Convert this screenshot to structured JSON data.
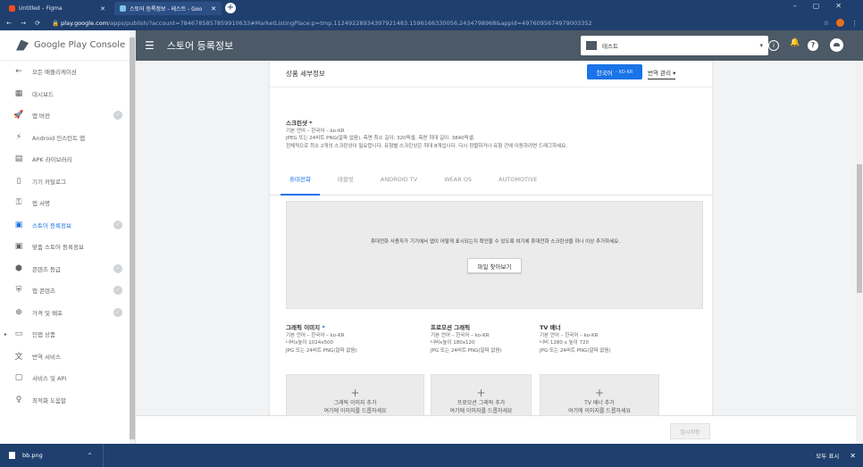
{
  "browser": {
    "tabs": [
      {
        "title": "Untitled – Figma",
        "active": false
      },
      {
        "title": "스토어 등록정보 - 테스트 - Goo",
        "active": true
      }
    ],
    "new_tab": "+",
    "url_domain": "play.google.com",
    "url_rest": "/apps/publish/?account=7846785857859910633#MarketListingPlace:p=tmp.112492289343979214​83.1596166330056.2434798968&appid=4976095674979003352"
  },
  "appbar": {
    "title": "스토어 등록정보",
    "app_selector": "테스트"
  },
  "sidebar": {
    "logo": "Google Play Console",
    "items": [
      {
        "label": "모든 애플리케이션",
        "icon": "←"
      },
      {
        "label": "대시보드",
        "icon": "▦"
      },
      {
        "label": "앱 버전",
        "icon": "🚀",
        "check": "✓"
      },
      {
        "label": "Android 인스턴트 앱",
        "icon": "⚡"
      },
      {
        "label": "APK 라이브러리",
        "icon": "▤"
      },
      {
        "label": "기기 카탈로그",
        "icon": "▯"
      },
      {
        "label": "앱 서명",
        "icon": "⚿"
      },
      {
        "label": "스토어 등록정보",
        "icon": "▣",
        "check": "✓"
      },
      {
        "label": "맞춤 스토어 등록정보",
        "icon": "▣"
      },
      {
        "label": "콘텐츠 등급",
        "icon": "⬢",
        "check": "✓"
      },
      {
        "label": "앱 콘텐츠",
        "icon": "⛨",
        "check": "✓"
      },
      {
        "label": "가격 및 배포",
        "icon": "⊕",
        "check": "✓"
      },
      {
        "label": "인앱 상품",
        "icon": "▭"
      },
      {
        "label": "번역 서비스",
        "icon": "文"
      },
      {
        "label": "서비스 및 API",
        "icon": "▢"
      },
      {
        "label": "최적화 도움말",
        "icon": "♀"
      }
    ]
  },
  "card": {
    "header": "상품 세부정보",
    "language_button": "한국어",
    "language_code": "– KO-KR",
    "translate_label": "번역 관리",
    "screenshot": {
      "title": "스크린샷 *",
      "line1": "기본 언어 – 한국어 – ko-KR",
      "line2": "JPEG 또는 24비트 PNG(알파 없음). 측면 최소 길이: 320픽셀, 측면 최대 길이: 3840픽셀.",
      "line3": "전체적으로 최소 2개의 스크린샷이 필요합니다. 유형별 스크린샷은 최대 8개입니다. 다시 정렬하거나 유형 간에 이동하려면 드래그하세요."
    },
    "tabs": [
      "휴대전화",
      "태블릿",
      "ANDROID TV",
      "WEAR OS",
      "AUTOMOTIVE"
    ],
    "drop_text": "휴대전화 사용자가 기기에서 앱이 어떻게 표시되는지 확인할 수 있도록 여기에 휴대전화 스크린샷을 하나 이상 추가하세요.",
    "browse_button": "파일 찾아보기",
    "graphics": [
      {
        "title": "그래픽 이미지",
        "required": "*",
        "lang": "기본 언어 – 한국어 – ko-KR",
        "size": "너비x높이 1024x500",
        "format": "JPG 또는 24비트 PNG(알파 없음)",
        "upload": "그래픽 이미지 추가",
        "upload_sub": "여기에 이미지를 드롭하세요"
      },
      {
        "title": "프로모션 그래픽",
        "required": "",
        "lang": "기본 언어 – 한국어 – ko-KR",
        "size": "너비x높이 180x120",
        "format": "JPG 또는 24비트 PNG(알파 없음)",
        "upload": "프로모션 그래픽 추가",
        "upload_sub": "여기에 이미지를 드롭하세요"
      },
      {
        "title": "TV 배너",
        "required": "",
        "lang": "기본 언어 – 한국어 – ko-KR",
        "size": "너비 1280 x 높이 720",
        "format": "JPG 또는 24비트 PNG(알파 없음)",
        "upload": "TV 배너 추가",
        "upload_sub": "여기에 이미지를 드롭하세요"
      }
    ]
  },
  "footer": {
    "save_draft": "임시저장"
  },
  "downloads": {
    "file": "bb.png",
    "show_all": "모두 표시",
    "close": "✕"
  },
  "colors": {
    "accent": "#1a73e8",
    "appbar": "#4c5966",
    "browser": "#1f3f6e"
  }
}
